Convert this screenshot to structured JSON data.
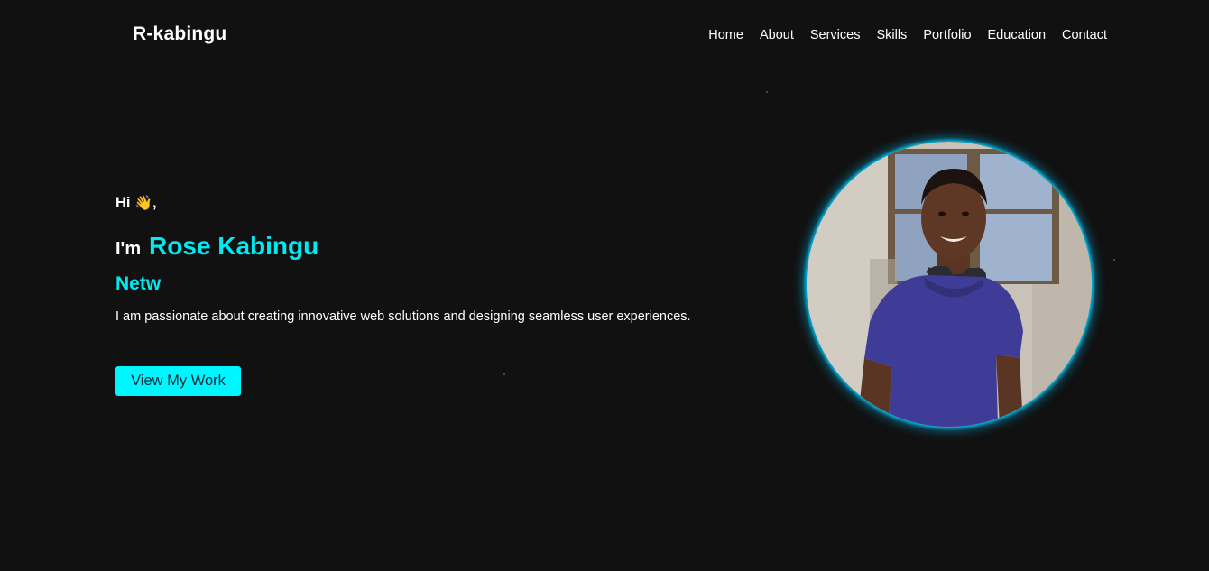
{
  "header": {
    "logo": "R-kabingu",
    "nav": [
      {
        "label": "Home"
      },
      {
        "label": "About"
      },
      {
        "label": "Services"
      },
      {
        "label": "Skills"
      },
      {
        "label": "Portfolio"
      },
      {
        "label": "Education"
      },
      {
        "label": "Contact"
      }
    ]
  },
  "hero": {
    "greeting": "Hi",
    "greeting_emoji": "👋",
    "greeting_comma": ",",
    "im": "I'm",
    "name": "Rose Kabingu",
    "role_typed": "Netw",
    "tagline": "I am passionate about creating innovative web solutions and designing seamless user experiences.",
    "cta_label": "View My Work"
  },
  "profile_image": {
    "icon": "profile-photo"
  },
  "colors": {
    "background": "#111111",
    "accent": "#00eaf2",
    "button": "#00f6ff",
    "text": "#ffffff"
  }
}
